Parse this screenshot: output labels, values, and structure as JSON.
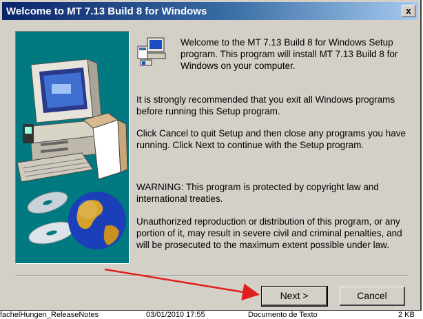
{
  "window": {
    "title": "Welcome to MT 7.13 Build 8 for Windows",
    "close_glyph": "x"
  },
  "content": {
    "welcome": "Welcome to the MT 7.13 Build 8 for Windows Setup program.  This program will install MT 7.13 Build 8 for Windows on your computer.",
    "recommend": "It is strongly recommended that you exit all Windows programs before running this Setup program.",
    "cancel_info": "Click Cancel to quit Setup and then close any programs you have running.  Click Next to continue with the Setup program.",
    "warning": "WARNING: This program is protected by copyright law and international treaties.",
    "unauthorized": "Unauthorized reproduction or distribution of this program, or any portion of it, may result in severe civil and criminal penalties, and will be prosecuted to the maximum extent possible under law."
  },
  "buttons": {
    "next": "Next >",
    "cancel": "Cancel"
  },
  "background_strip": {
    "name": "fachelHungen_ReleaseNotes",
    "date": "03/01/2010 17:55",
    "type": "Documento de Texto",
    "size": "2 KB"
  },
  "colors": {
    "titlebar_start": "#0a246a",
    "titlebar_end": "#a6caf0",
    "panel_bg": "#007a80",
    "dialog_bg": "#d4d0c8",
    "annotation_arrow": "#e0201c"
  },
  "icons": {
    "setup": "setup-computer-icon",
    "graphic": "computer-cd-globe-graphic",
    "annotation": "red-arrow-annotation"
  }
}
